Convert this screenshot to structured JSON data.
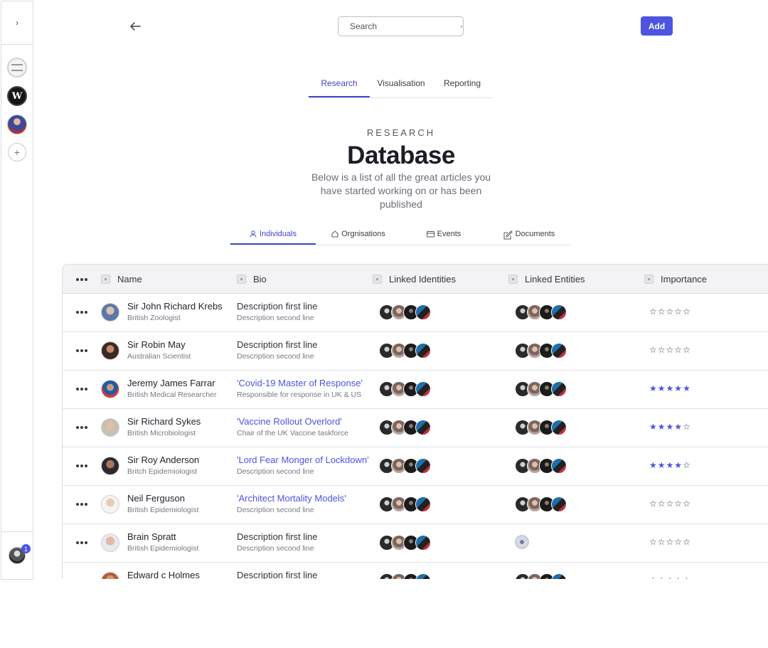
{
  "nav": {
    "collapse_icon": "chevron-right-icon",
    "add_workspace_icon": "plus-icon",
    "notification_count": "1"
  },
  "header": {
    "back_icon": "arrow-left-icon",
    "search_placeholder": "Search",
    "add_label": "Add"
  },
  "top_tabs": [
    {
      "label": "Research",
      "active": true
    },
    {
      "label": "Visualisation",
      "active": false
    },
    {
      "label": "Reporting",
      "active": false
    }
  ],
  "hero": {
    "eyebrow": "RESEARCH",
    "title": "Database",
    "subtitle": "Below is a list of all the great articles you have started working on or has been published"
  },
  "entity_tabs": [
    {
      "label": "Individuals",
      "icon": "person-icon",
      "active": true
    },
    {
      "label": "Orgnisations",
      "icon": "building-icon",
      "active": false
    },
    {
      "label": "Events",
      "icon": "calendar-icon",
      "active": false
    },
    {
      "label": "Documents",
      "icon": "edit-document-icon",
      "active": false
    }
  ],
  "table": {
    "columns": [
      "Name",
      "Bio",
      "Linked Identities",
      "Linked Entities",
      "Importance"
    ],
    "rows": [
      {
        "name": "Sir John Richard Krebs",
        "role": "British Zoologist",
        "bio1": "Description first line",
        "bio2": "Description second line",
        "highlight": false,
        "rating": 0,
        "entities": "faces"
      },
      {
        "name": "Sir Robin May",
        "role": "Australian  Scientist",
        "bio1": "Description first line",
        "bio2": "Description second line",
        "highlight": false,
        "rating": 0,
        "entities": "faces"
      },
      {
        "name": "Jeremy James Farrar",
        "role": "British Medical Researcher",
        "bio1": "'Covid-19 Master of Response'",
        "bio2": "Responsible for response in UK & US",
        "highlight": true,
        "rating": 5,
        "entities": "faces"
      },
      {
        "name": "Sir Richard Sykes",
        "role": "British Microbiologist",
        "bio1": "'Vaccine Rollout Overlord'",
        "bio2": "Chair of the UK Vaccine taskforce",
        "highlight": true,
        "rating": 4,
        "entities": "faces"
      },
      {
        "name": "Sir Roy Anderson",
        "role": "Britch Epidemiologist",
        "bio1": "'Lord Fear Monger of Lockdown'",
        "bio2": "Description second line",
        "highlight": true,
        "rating": 4,
        "entities": "faces"
      },
      {
        "name": "Neil Ferguson",
        "role": "British Epidemiologist",
        "bio1": "'Architect Mortality Models'",
        "bio2": "Description second line",
        "highlight": true,
        "rating": 0,
        "entities": "faces"
      },
      {
        "name": "Brain Spratt",
        "role": "British Epidemiologist",
        "bio1": "Description first line",
        "bio2": "Description second line",
        "highlight": false,
        "rating": 0,
        "entities": "seal"
      },
      {
        "name": "Edward c Holmes",
        "role": "",
        "bio1": "Description first line",
        "bio2": "",
        "highlight": false,
        "rating": 0,
        "entities": "faces"
      }
    ]
  },
  "colors": {
    "accent": "#4d54e0",
    "border": "#dcdce2",
    "header_bg": "#f3f3f5"
  }
}
